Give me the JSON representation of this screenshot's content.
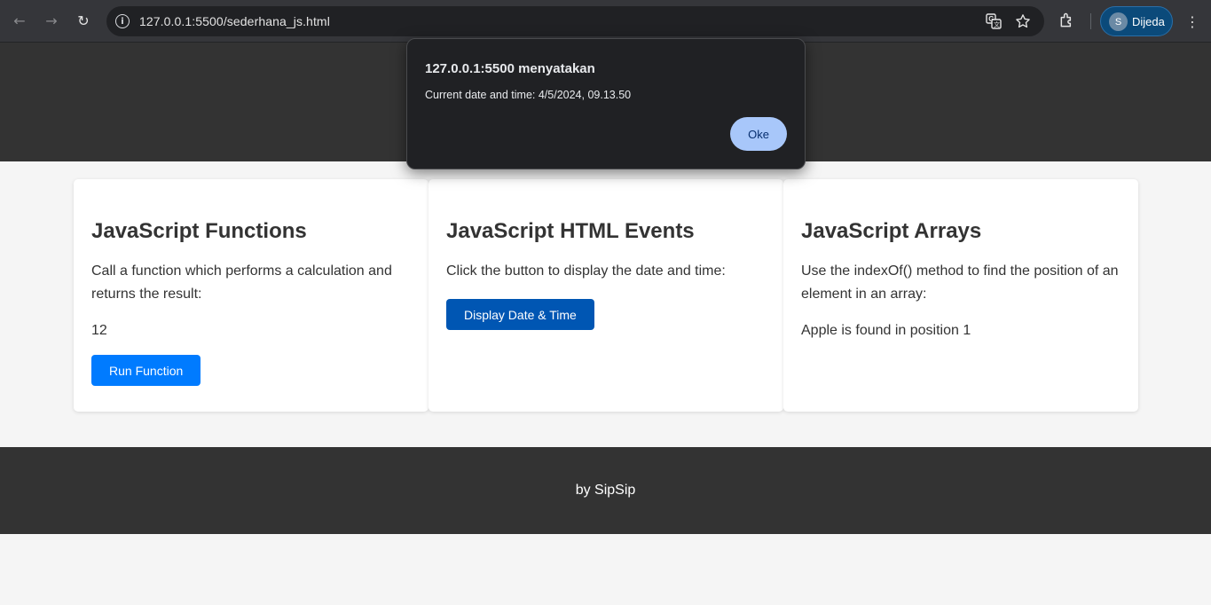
{
  "browser": {
    "url": "127.0.0.1:5500/sederhana_js.html",
    "profile_initial": "S",
    "profile_name": "Dijeda",
    "icons": [
      "back-icon",
      "forward-icon",
      "reload-icon",
      "site-info-icon",
      "translate-icon",
      "bookmark-star-icon",
      "extensions-icon",
      "menu-icon"
    ]
  },
  "cards": [
    {
      "title": "JavaScript Functions",
      "description": "Call a function which performs a calculation and returns the result:",
      "result": "12",
      "button_label": "Run Function"
    },
    {
      "title": "JavaScript HTML Events",
      "description": "Click the button to display the date and time:",
      "button_label": "Display Date & Time"
    },
    {
      "title": "JavaScript Arrays",
      "description": "Use the indexOf() method to find the position of an element in an array:",
      "result": "Apple is found in position 1"
    }
  ],
  "footer": {
    "text": "by SipSip"
  },
  "dialog": {
    "title": "127.0.0.1:5500 menyatakan",
    "message": "Current date and time: 4/5/2024, 09.13.50",
    "ok_label": "Oke"
  },
  "colors": {
    "header_bg": "#333333",
    "run_button": "#007bff",
    "date_button": "#0056b3",
    "dialog_ok": "#a8c7fa"
  }
}
